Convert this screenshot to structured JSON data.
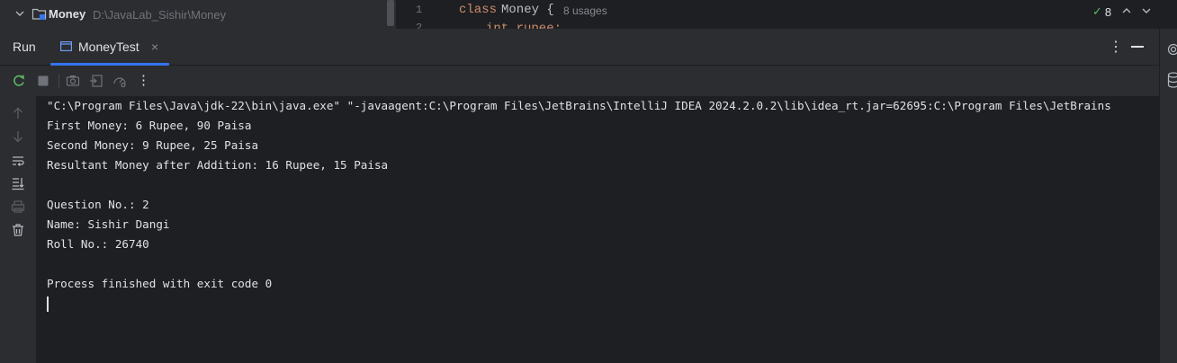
{
  "project": {
    "name": "Money",
    "path": "D:\\JavaLab_Sishir\\Money"
  },
  "editor": {
    "line_numbers": [
      "1",
      "2"
    ],
    "keyword": "class",
    "class_name": "Money {",
    "usages": "8 usages",
    "line2_partial": "int rupee; ",
    "inspection_count": "8"
  },
  "run_window": {
    "title": "Run",
    "tab_label": "MoneyTest",
    "tab_close": "×",
    "more_icon": "⋮"
  },
  "toolbar": {
    "icons": [
      "rerun-icon",
      "stop-icon",
      "screenshot-icon",
      "restore-layout-icon",
      "settings-icon",
      "more-options-icon"
    ],
    "more_label": "⋮"
  },
  "left_tools": {
    "icons": [
      "up-arrow-icon",
      "down-arrow-icon",
      "soft-wrap-icon",
      "scroll-to-end-icon",
      "print-icon",
      "trash-icon"
    ]
  },
  "console": {
    "lines": [
      "\"C:\\Program Files\\Java\\jdk-22\\bin\\java.exe\" \"-javaagent:C:\\Program Files\\JetBrains\\IntelliJ IDEA 2024.2.0.2\\lib\\idea_rt.jar=62695:C:\\Program Files\\JetBrains",
      "First Money: 6 Rupee, 90 Paisa",
      "Second Money: 9 Rupee, 25 Paisa",
      "Resultant Money after Addition: 16 Rupee, 15 Paisa",
      "",
      "Question No.: 2",
      "Name: Sishir Dangi",
      "Roll No.: 26740",
      "",
      "Process finished with exit code 0"
    ]
  },
  "colors": {
    "panel_bg": "#2b2d30",
    "editor_bg": "#1e1f22",
    "accent": "#3574f0",
    "keyword": "#cf8e6d",
    "success": "#5fb865"
  }
}
